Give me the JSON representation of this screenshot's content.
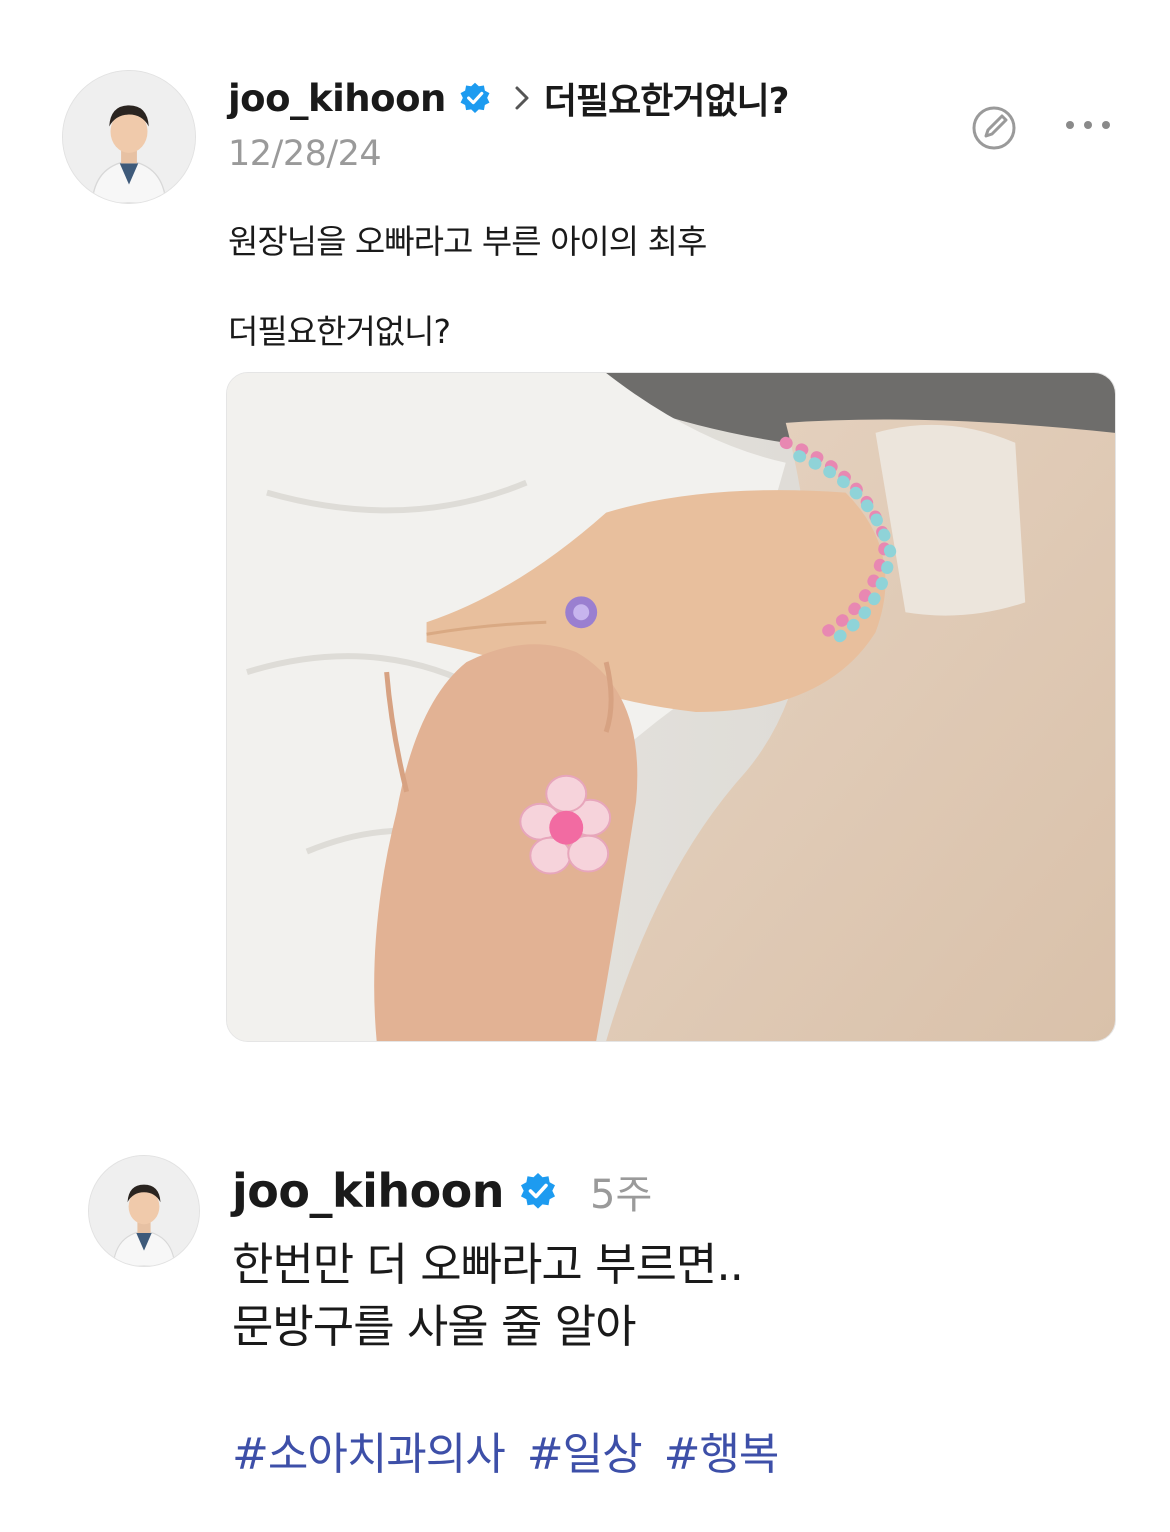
{
  "post": {
    "username": "joo_kihoon",
    "thread_title": "더필요한거없니?",
    "date": "12/28/24",
    "text_line_1": "원장님을 오빠라고 부른 아이의 최후",
    "text_line_2": "더필요한거없니?"
  },
  "reply": {
    "username": "joo_kihoon",
    "time": "5주",
    "text_line_1": "한번만 더 오빠라고 부르면..",
    "text_line_2": "문방구를 사올 줄 알아",
    "hashtags": [
      "#소아치과의사",
      "#일상",
      "#행복"
    ]
  },
  "icons": {
    "verified": "verified-badge-icon",
    "chevron": "chevron-right-icon",
    "edit": "edit-icon",
    "more": "more-options-icon"
  },
  "colors": {
    "verified_blue": "#1d9bf0",
    "hashtag": "#3d4fa8",
    "meta_gray": "#9a9a9a"
  }
}
